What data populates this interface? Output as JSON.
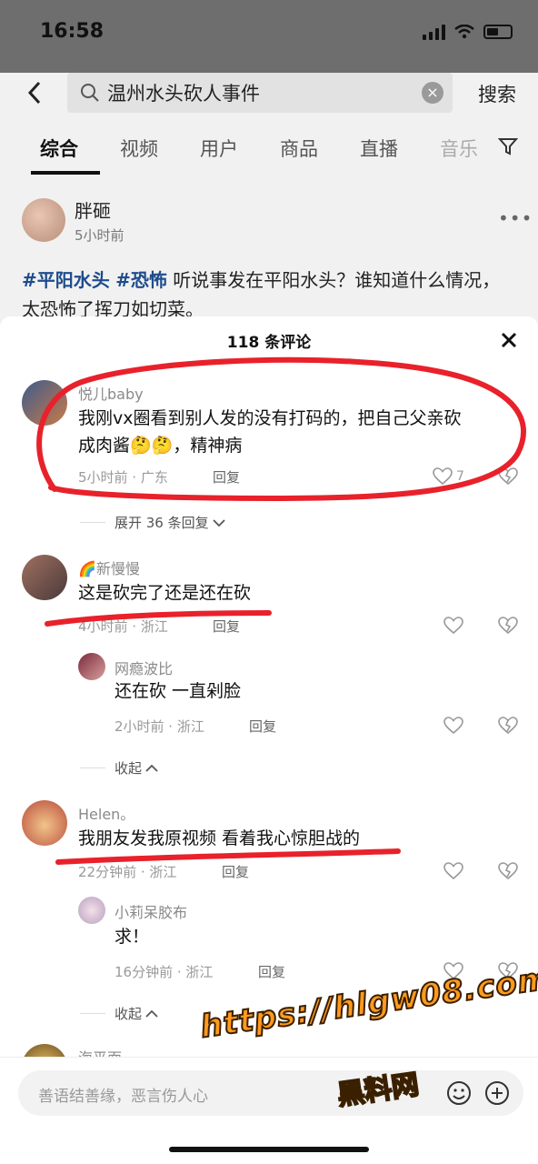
{
  "status_bar": {
    "time": "16:58"
  },
  "search": {
    "query": "温州水头砍人事件",
    "submit_label": "搜索"
  },
  "tabs": [
    {
      "label": "综合",
      "active": true
    },
    {
      "label": "视频"
    },
    {
      "label": "用户"
    },
    {
      "label": "商品"
    },
    {
      "label": "直播"
    },
    {
      "label": "音乐"
    }
  ],
  "post": {
    "author": "胖砸",
    "time": "5小时前",
    "tags": [
      "#平阳水头",
      "#恐怖"
    ],
    "text": " 听说事发在平阳水头？谁知道什么情况，太恐怖了挥刀如切菜。"
  },
  "comments_sheet": {
    "title": "118 条评论",
    "comments": [
      {
        "user": "悦儿baby",
        "text_line1": "我刚vx圈看到别人发的没有打码的，把自己父亲砍",
        "text_line2": "成肉酱🤔🤔，精神病",
        "meta": "5小时前 · 广东",
        "reply_label": "回复",
        "like_count": "7",
        "expand_label": "展开 36 条回复"
      },
      {
        "user": "🌈新慢慢",
        "text": "这是砍完了还是还在砍",
        "meta": "4小时前 · 浙江",
        "reply_label": "回复",
        "reply": {
          "user": "网瘾波比",
          "text": "还在砍 一直剁脸",
          "meta": "2小时前 · 浙江",
          "reply_label": "回复"
        },
        "collapse_label": "收起"
      },
      {
        "user": "Helen。",
        "text": "我朋友发我原视频 看着我心惊胆战的",
        "meta": "22分钟前 · 浙江",
        "reply_label": "回复",
        "reply": {
          "user": "小莉呆胶布",
          "text": "求！",
          "meta": "16分钟前 · 浙江",
          "reply_label": "回复"
        },
        "collapse_label": "收起"
      },
      {
        "user": "海平面"
      }
    ]
  },
  "input_bar": {
    "placeholder": "善语结善缘，恶言伤人心"
  },
  "watermark": {
    "url": "https://hlgw08.com",
    "name": "黑料网"
  },
  "colors": {
    "annotation_red": "#e8212b",
    "tag_blue": "#1e4c8c",
    "watermark_orange": "#ff9a1e"
  }
}
